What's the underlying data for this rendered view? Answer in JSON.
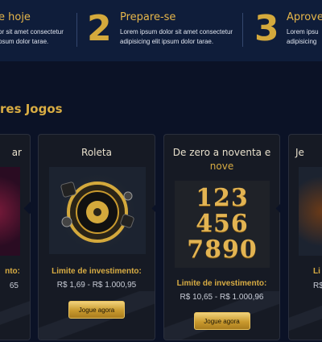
{
  "steps": [
    {
      "number": "",
      "title": "e hoje",
      "desc_line1": "or sit amet consectetur",
      "desc_line2": "psum dolor tarae."
    },
    {
      "number": "2",
      "title": "Prepare-se",
      "desc_line1": "Lorem ipsum dolor sit amet consectetur",
      "desc_line2": "adipisicing elit ipsum dolor tarae."
    },
    {
      "number": "3",
      "title": "Aprovei",
      "desc_line1": "Lorem ipsu",
      "desc_line2": "adipisicing"
    }
  ],
  "section_title": "res Jogos",
  "cards": [
    {
      "title": "ar",
      "limit_label": "nto:",
      "range": "65"
    },
    {
      "title": "Roleta",
      "limit_label": "Limite de investimento:",
      "range": "R$ 1,69 - R$ 1.000,95",
      "button": "Jogue agora"
    },
    {
      "title_line1": "De zero a noventa e",
      "title_line2": "nove",
      "art_line1": "123",
      "art_line2": "456",
      "art_line3": "7890",
      "limit_label": "Limite de investimento:",
      "range": "R$ 10,65 - R$ 1.000,96",
      "button": "Jogue agora"
    },
    {
      "title": "Je",
      "limit_label": "Li",
      "range": "R$"
    }
  ],
  "colors": {
    "background": "#0b1226",
    "band": "#0f1d3a",
    "gold": "#d8ac43",
    "card": "#161a24"
  }
}
